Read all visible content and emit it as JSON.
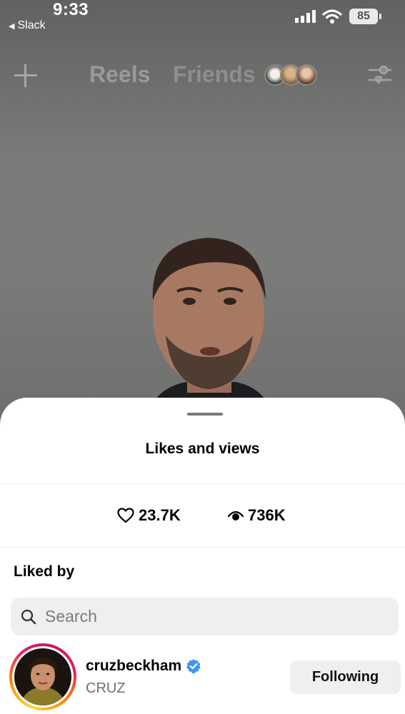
{
  "status_bar": {
    "time": "9:33",
    "back_app": "Slack",
    "battery": "85"
  },
  "top_nav": {
    "tab_reels": "Reels",
    "tab_friends": "Friends"
  },
  "sheet": {
    "title": "Likes and views",
    "stats": {
      "likes": "23.7K",
      "views": "736K"
    },
    "liked_by_label": "Liked by",
    "search": {
      "placeholder": "Search"
    },
    "users": [
      {
        "username": "cruzbeckham",
        "full_name": "CRUZ",
        "verified": true,
        "button_label": "Following"
      }
    ]
  },
  "colors": {
    "verified_badge": "#3897f0",
    "sheet_bg": "#ffffff",
    "button_bg": "#efefef"
  },
  "icons": {
    "plus": "plus-icon",
    "filter": "filter-icon",
    "heart": "heart-icon",
    "eye": "eye-icon",
    "search": "search-icon",
    "verified": "verified-badge-icon"
  }
}
